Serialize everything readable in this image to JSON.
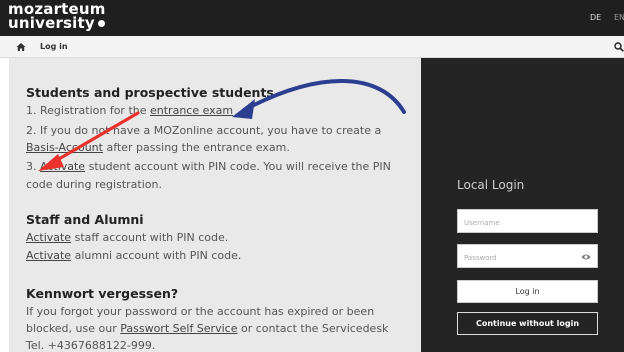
{
  "header": {
    "logo_line1": "mozarteum",
    "logo_line2": "university",
    "lang_de": "DE",
    "lang_en": "EN"
  },
  "nav": {
    "home_icon": "home-icon",
    "label": "Log in",
    "search_icon": "search-icon"
  },
  "content": {
    "students": {
      "heading": "Students and prospective students",
      "line1_prefix": "1. Registration for the ",
      "line1_link": "entrance exam",
      "line2_text": "2. If you do not have a MOZonline account, you have to create a",
      "line3_link": "Basis-Account",
      "line3_suffix": " after passing the entrance exam.",
      "line4_prefix": "3. ",
      "line4_link": "Activate",
      "line4_suffix": " student account with PIN code. You will receive the PIN",
      "line5_text": "code during registration."
    },
    "staff": {
      "heading": "Staff and Alumni",
      "line1_link": "Activate",
      "line1_suffix": " staff account with PIN code.",
      "line2_link": "Activate",
      "line2_suffix": " alumni account with PIN code."
    },
    "password": {
      "heading": "Kennwort vergessen?",
      "line1_text": "If you forgot your password or the account has expired or been",
      "line2_prefix": "blocked, use our ",
      "line2_link": "Passwort Self Service",
      "line2_suffix": " or contact the Servicedesk",
      "line3_text": "Tel. +4367688122-999."
    }
  },
  "login": {
    "title": "Local Login",
    "username_placeholder": "Username",
    "password_placeholder": "Password",
    "eye_icon": "eye-icon",
    "login_button": "Log in",
    "continue_button": "Continue without login"
  },
  "annotations": {
    "red_arrow_icon": "red-arrow-icon",
    "blue_arrow_icon": "blue-curved-arrow-icon",
    "red_color": "#e8322b",
    "blue_color": "#2c3e8f"
  }
}
